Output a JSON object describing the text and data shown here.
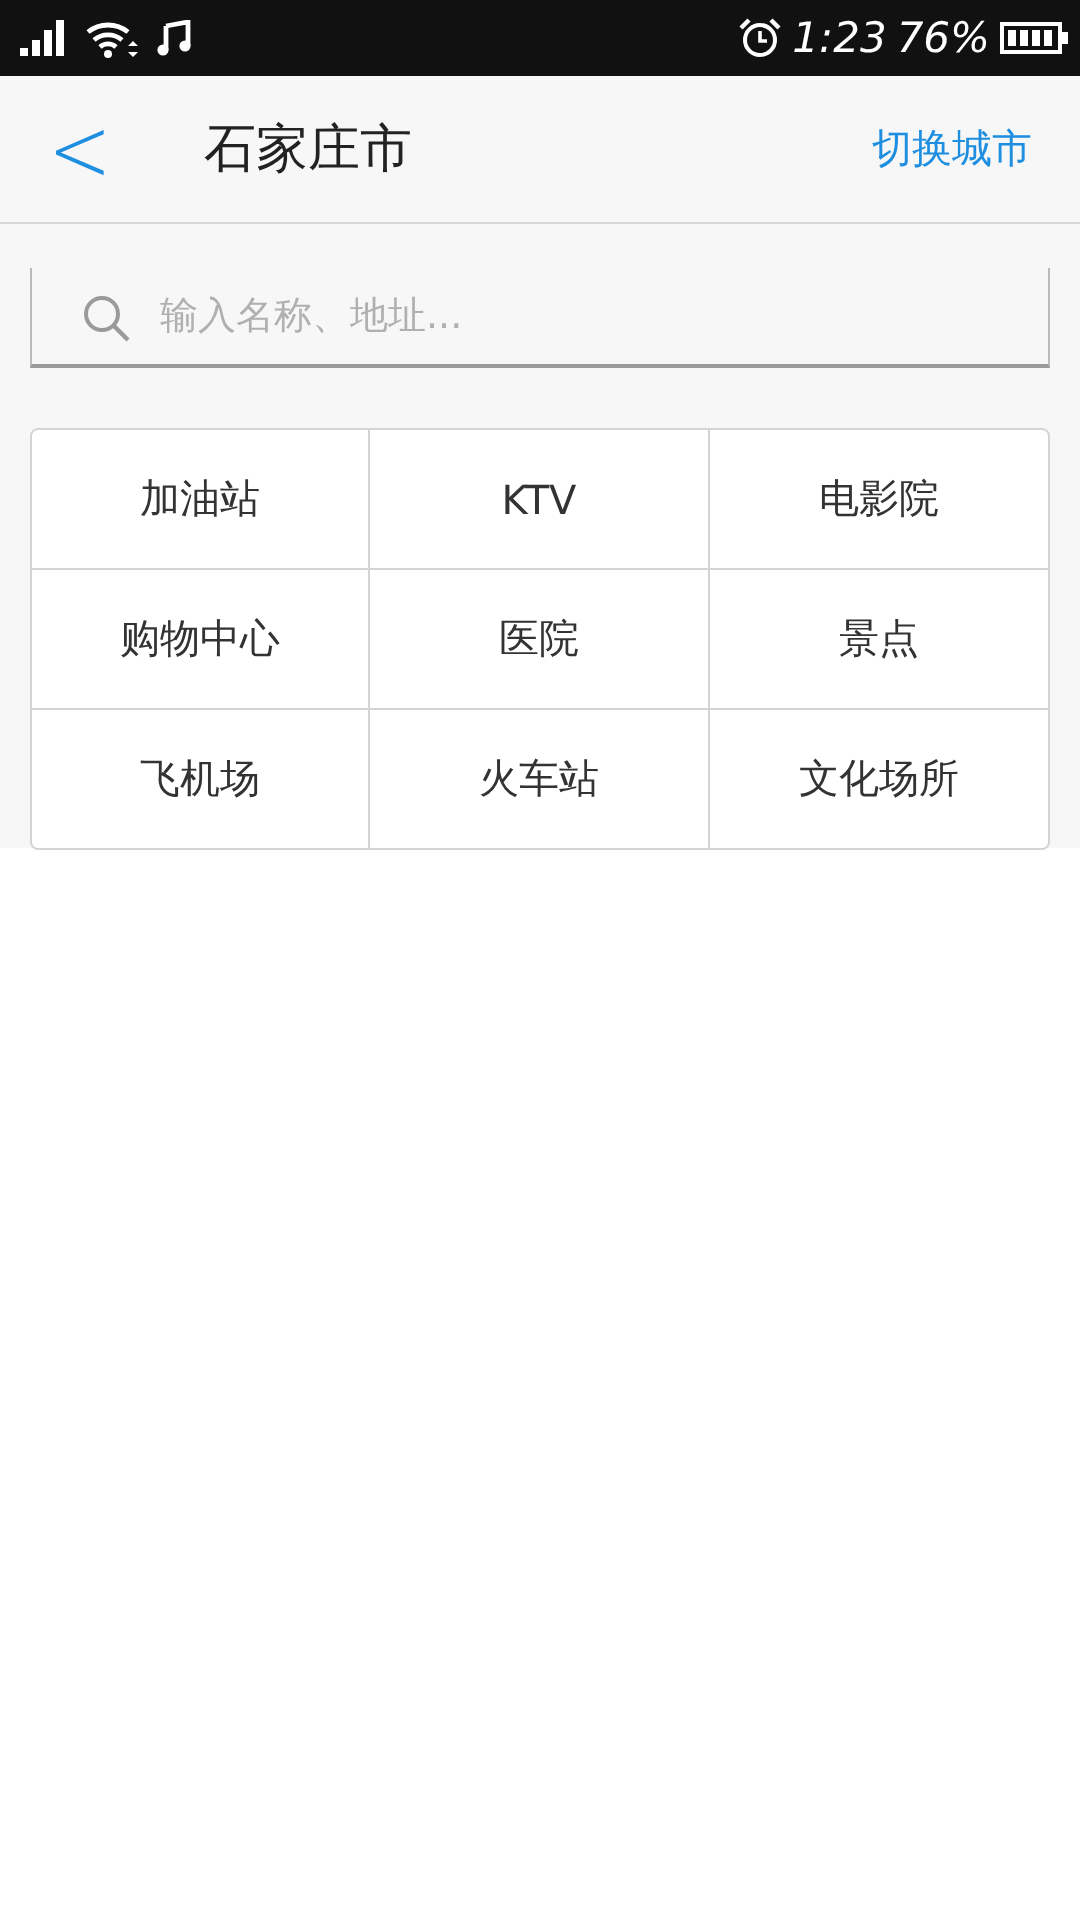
{
  "status_bar": {
    "time": "1:23",
    "battery": "76%"
  },
  "header": {
    "back": "<",
    "title": "石家庄市",
    "action": "切换城市"
  },
  "search": {
    "placeholder": "输入名称、地址..."
  },
  "categories": [
    {
      "label": "加油站"
    },
    {
      "label": "KTV"
    },
    {
      "label": "电影院"
    },
    {
      "label": "购物中心"
    },
    {
      "label": "医院"
    },
    {
      "label": "景点"
    },
    {
      "label": "飞机场"
    },
    {
      "label": "火车站"
    },
    {
      "label": "文化场所"
    }
  ]
}
